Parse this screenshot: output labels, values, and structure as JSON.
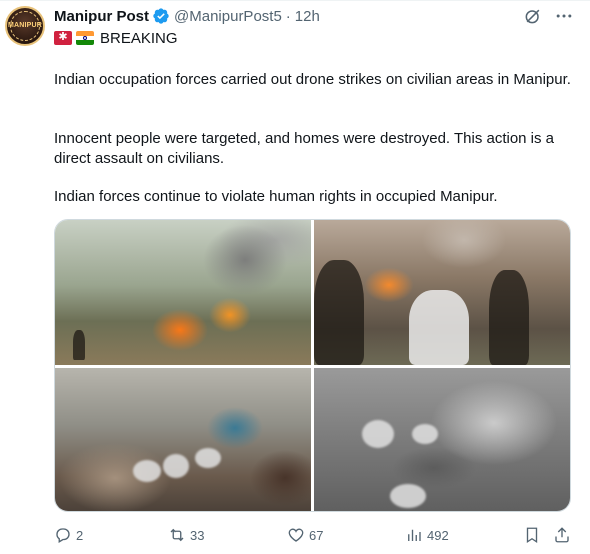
{
  "author": {
    "name": "Manipur Post",
    "handle": "@ManipurPost5",
    "separator": "·",
    "time": "12h",
    "avatar_label": "MANIPUR"
  },
  "tweet": {
    "tag_text": "BREAKING",
    "paragraphs": [
      "Indian occupation forces carried out drone strikes on civilian areas in Manipur.",
      "Innocent people were targeted, and homes were destroyed. This action is a direct assault on civilians.",
      "Indian forces continue to violate human rights in occupied Manipur."
    ]
  },
  "actions": {
    "replies": "2",
    "reposts": "33",
    "likes": "67",
    "views": "492"
  },
  "icons": {
    "verified": "verified-badge-icon",
    "grok": "grok-icon",
    "more": "more-icon",
    "reply": "reply-icon",
    "repost": "repost-icon",
    "like": "heart-icon",
    "views": "views-icon",
    "bookmark": "bookmark-icon",
    "share": "share-icon"
  },
  "colors": {
    "accent": "#1d9bf0",
    "secondary_text": "#536471",
    "primary_text": "#0f1419"
  }
}
